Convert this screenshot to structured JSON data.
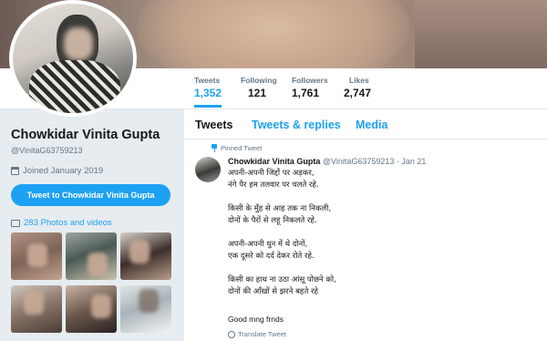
{
  "profile": {
    "name": "Chowkidar Vinita Gupta",
    "handle": "@VinitaG63759213",
    "joined": "Joined January 2019",
    "tweet_to_label": "Tweet to Chowkidar Vinita Gupta",
    "photos_label": "283 Photos and videos"
  },
  "stats": [
    {
      "label": "Tweets",
      "value": "1,352"
    },
    {
      "label": "Following",
      "value": "121"
    },
    {
      "label": "Followers",
      "value": "1,761"
    },
    {
      "label": "Likes",
      "value": "2,747"
    }
  ],
  "tabs": [
    {
      "label": "Tweets"
    },
    {
      "label": "Tweets & replies"
    },
    {
      "label": "Media"
    }
  ],
  "tweet": {
    "pinned_label": "Pinned Tweet",
    "author": "Chowkidar Vinita Gupta",
    "handle_date": "@VinitaG63759213 · Jan 21",
    "lines": [
      "अपनी-अपनी जिद्दों पर अड़कर,",
      "नंगे पैर हम तलवार पर चलते रहे.",
      "",
      "किसी के मुँह से आह तक ना निकली,",
      "दोनों के पैरों से लहू निकलते रहे.",
      "",
      "अपनी-अपनी धुन में थे दोनों,",
      "एक दूसरे को दर्द देकर रोते रहे.",
      "",
      "किसी का हाथ ना उठा आंसू पोछने को,",
      "दोनों की आँखों से झरने बहते रहे"
    ],
    "greeting": "Good mng frnds",
    "translate_label": "Translate Tweet"
  },
  "colors": {
    "accent": "#1da1f2",
    "text": "#14171a",
    "muted": "#657786",
    "background": "#e6ecf0"
  }
}
